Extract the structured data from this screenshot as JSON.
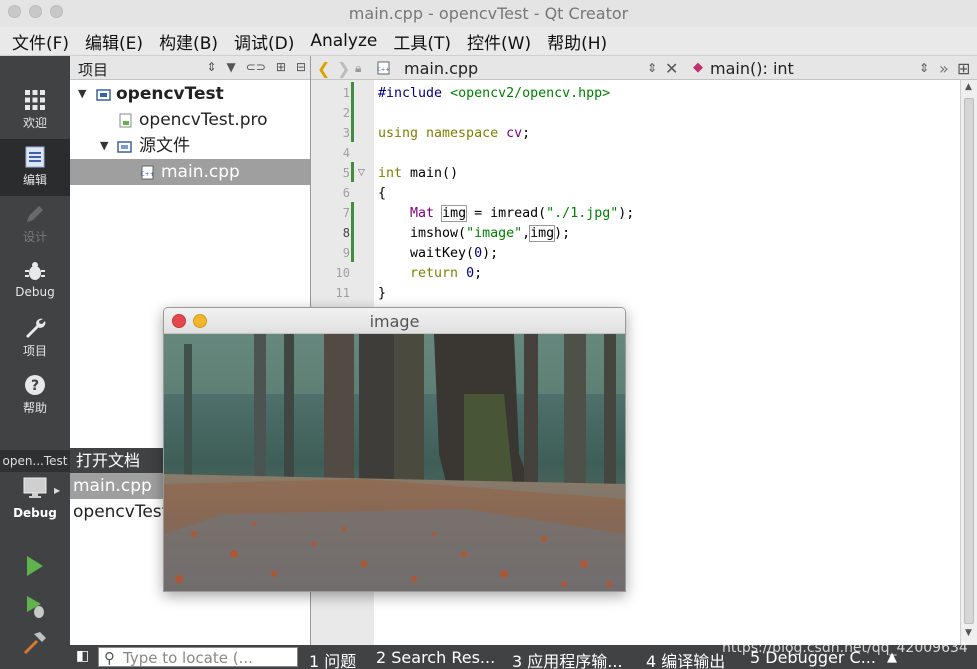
{
  "window": {
    "title": "main.cpp - opencvTest - Qt Creator"
  },
  "menu": [
    "文件(F)",
    "编辑(E)",
    "构建(B)",
    "调试(D)",
    "Analyze",
    "工具(T)",
    "控件(W)",
    "帮助(H)"
  ],
  "modes": [
    {
      "label": "欢迎",
      "icon": "grid-icon"
    },
    {
      "label": "编辑",
      "icon": "document-icon"
    },
    {
      "label": "设计",
      "icon": "pencil-icon"
    },
    {
      "label": "Debug",
      "icon": "bug-icon"
    },
    {
      "label": "项目",
      "icon": "wrench-icon"
    },
    {
      "label": "帮助",
      "icon": "help-icon"
    }
  ],
  "kit": {
    "name": "open...Test",
    "target": "Debug"
  },
  "projects": {
    "title": "项目",
    "tree": [
      {
        "label": "opencvTest"
      },
      {
        "label": "opencvTest.pro"
      },
      {
        "label": "源文件"
      },
      {
        "label": "main.cpp"
      }
    ]
  },
  "open_docs": {
    "title": "打开文档",
    "items": [
      "main.cpp",
      "opencvTest"
    ]
  },
  "editor": {
    "file": "main.cpp",
    "symbol": "main(): int",
    "line_numbers": [
      "1",
      "2",
      "3",
      "4",
      "5",
      "6",
      "7",
      "8",
      "9",
      "10",
      "11"
    ],
    "current_line": 8
  },
  "image_window": {
    "title": "image"
  },
  "status": {
    "locate_placeholder": "Type to locate (...",
    "panes": [
      "1 问题",
      "2 Search Res...",
      "3 应用程序输...",
      "4 编译输出",
      "5 Debugger C..."
    ],
    "watermark": "https://blog.csdn.net/qq_42009634"
  },
  "colors": {
    "sidebar": "#404244",
    "keyword": "#808000",
    "string": "#008000"
  }
}
